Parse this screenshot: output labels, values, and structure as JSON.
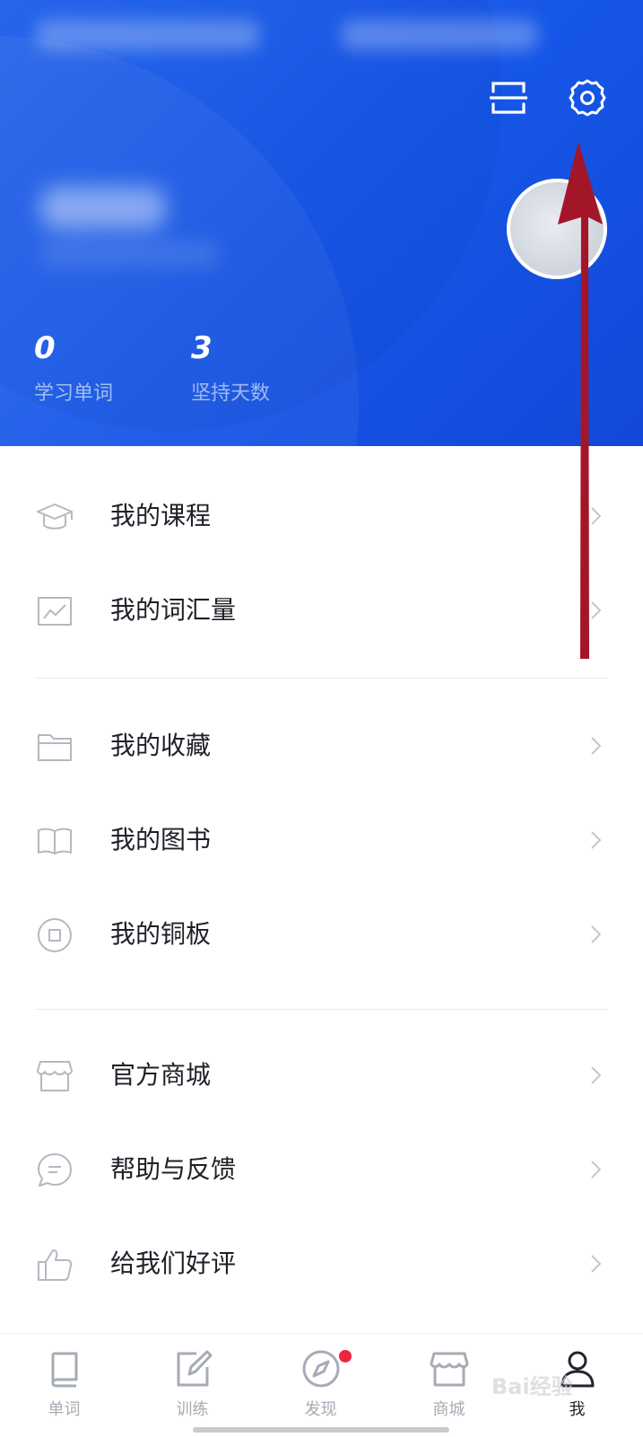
{
  "header": {
    "stats": [
      {
        "value": "0",
        "label": "学习单词"
      },
      {
        "value": "3",
        "label": "坚持天数"
      }
    ],
    "accent_color": "#1656e6"
  },
  "menu": {
    "groups": [
      [
        {
          "label": "我的课程",
          "icon": "graduation-cap-icon"
        },
        {
          "label": "我的词汇量",
          "icon": "line-chart-icon"
        }
      ],
      [
        {
          "label": "我的收藏",
          "icon": "folder-icon"
        },
        {
          "label": "我的图书",
          "icon": "book-open-icon"
        },
        {
          "label": "我的铜板",
          "icon": "coin-icon"
        }
      ],
      [
        {
          "label": "官方商城",
          "icon": "store-icon"
        },
        {
          "label": "帮助与反馈",
          "icon": "chat-bubble-icon"
        },
        {
          "label": "给我们好评",
          "icon": "thumbs-up-icon"
        }
      ]
    ]
  },
  "bottom_nav": {
    "items": [
      {
        "label": "单词",
        "icon": "book-icon"
      },
      {
        "label": "训练",
        "icon": "edit-icon"
      },
      {
        "label": "发现",
        "icon": "compass-icon",
        "badge": true
      },
      {
        "label": "商城",
        "icon": "store-icon"
      },
      {
        "label": "我",
        "icon": "person-icon",
        "active": true
      }
    ]
  },
  "annotation": {
    "arrow_color": "#a3162a"
  },
  "watermark": "Bai经验"
}
